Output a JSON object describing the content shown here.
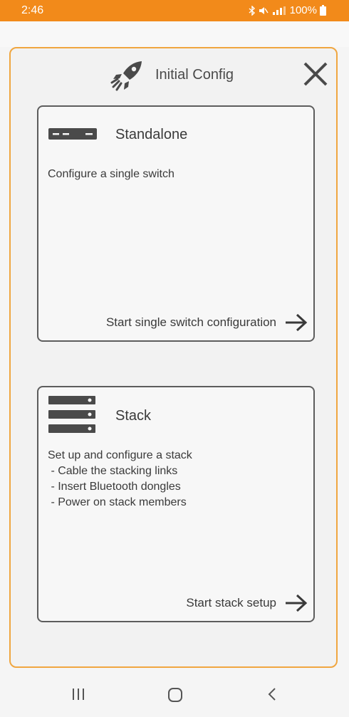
{
  "status_bar": {
    "time": "2:46",
    "battery": "100%",
    "icons": [
      "bluetooth-icon",
      "mute-icon",
      "signal-icon",
      "battery-icon"
    ]
  },
  "dialog": {
    "title": "Initial Config",
    "icon": "rocket-icon",
    "close_icon": "close-icon"
  },
  "cards": {
    "standalone": {
      "icon": "single-switch-icon",
      "title": "Standalone",
      "description": "Configure a single switch",
      "action_label": "Start single switch configuration",
      "action_icon": "arrow-right-icon"
    },
    "stack": {
      "icon": "switch-stack-icon",
      "title": "Stack",
      "description": "Set up and configure a stack\n - Cable the stacking links\n - Insert Bluetooth dongles\n - Power on stack members",
      "action_label": "Start stack setup",
      "action_icon": "arrow-right-icon"
    }
  },
  "nav_bar": {
    "icons": [
      "recent-apps-icon",
      "home-icon",
      "back-icon"
    ]
  },
  "colors": {
    "accent": "#f28a1a",
    "dialog_border": "#f0a640",
    "card_border": "#5d5d5d",
    "text": "#3a3a3a"
  }
}
